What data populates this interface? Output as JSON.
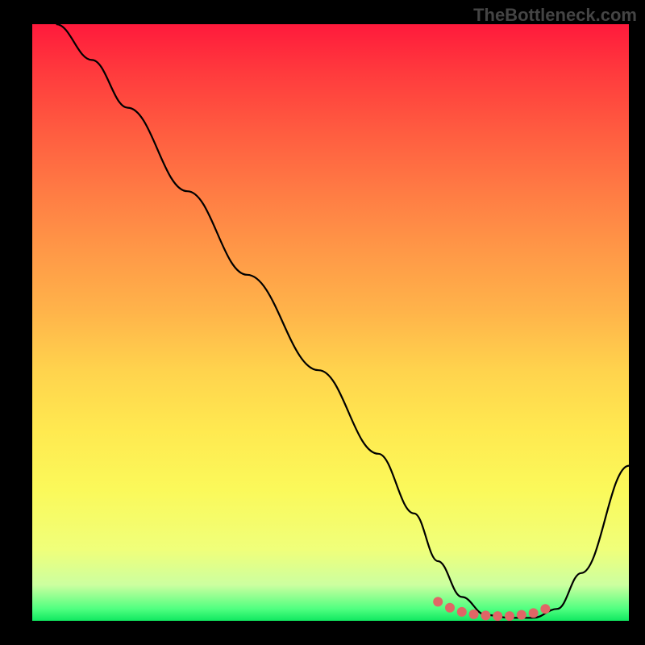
{
  "watermark": {
    "text": "TheBottleneck.com"
  },
  "chart_data": {
    "type": "line",
    "title": "",
    "xlabel": "",
    "ylabel": "",
    "xlim": [
      0,
      100
    ],
    "ylim": [
      0,
      100
    ],
    "series": [
      {
        "name": "curve",
        "x": [
          4,
          10,
          16,
          26,
          36,
          48,
          58,
          64,
          68,
          72,
          76,
          80,
          84,
          88,
          92,
          100
        ],
        "values": [
          100,
          94,
          86,
          72,
          58,
          42,
          28,
          18,
          10,
          4,
          1,
          0.5,
          0.5,
          2,
          8,
          26
        ]
      }
    ],
    "markers": {
      "name": "highlight-dots",
      "x": [
        68,
        70,
        72,
        74,
        76,
        78,
        80,
        82,
        84,
        86
      ],
      "values": [
        3.2,
        2.2,
        1.5,
        1.1,
        0.9,
        0.8,
        0.8,
        1.0,
        1.3,
        2.0
      ],
      "color": "#e06666",
      "size": 6
    }
  }
}
